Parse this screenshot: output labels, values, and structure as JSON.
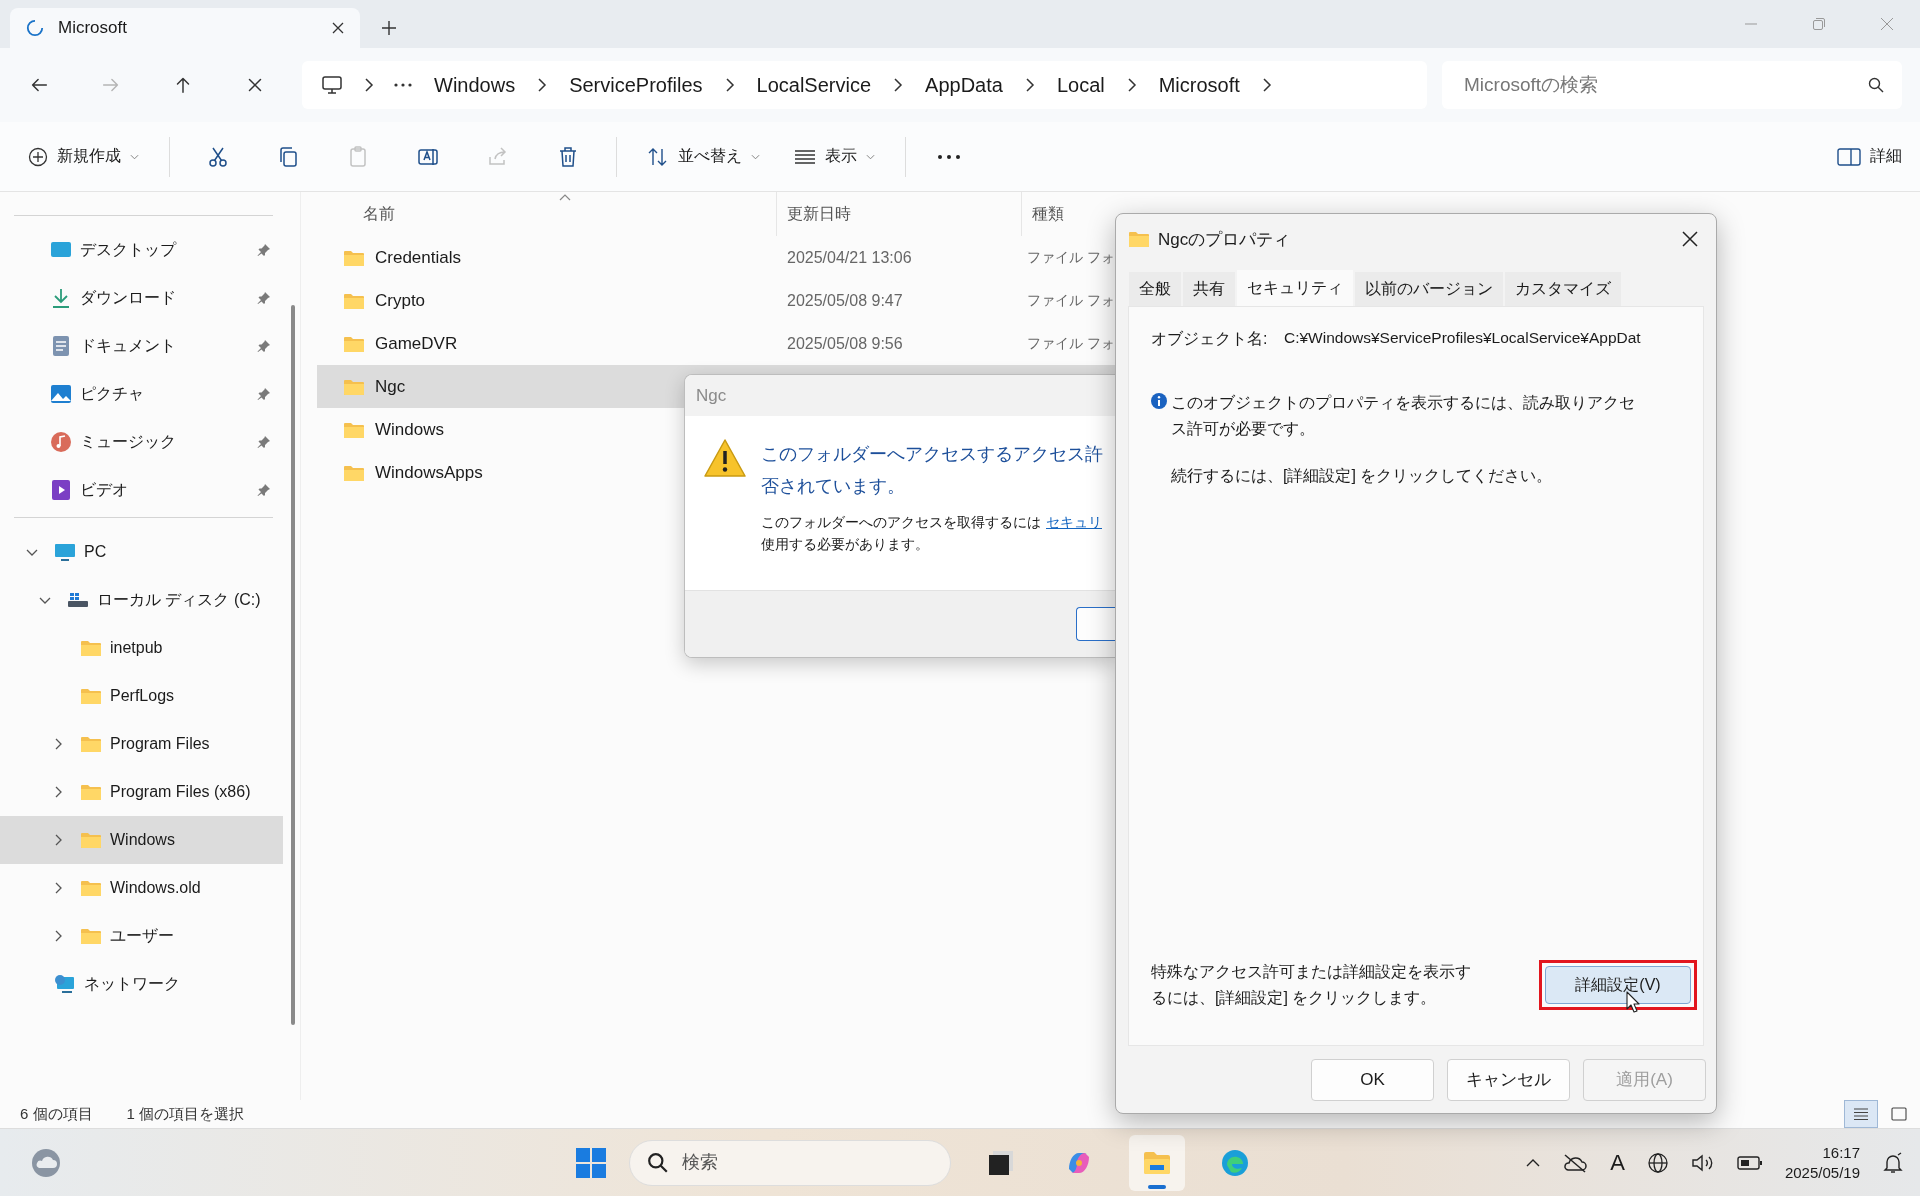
{
  "browser_tab": {
    "title": "Microsoft"
  },
  "nav_buttons": [
    {
      "kind": "back",
      "disabled": false
    },
    {
      "kind": "forward",
      "disabled": true
    },
    {
      "kind": "up",
      "disabled": false
    },
    {
      "kind": "stop",
      "disabled": false
    }
  ],
  "breadcrumbs": [
    "Windows",
    "ServiceProfiles",
    "LocalService",
    "AppData",
    "Local",
    "Microsoft"
  ],
  "search": {
    "placeholder": "Microsoftの検索"
  },
  "toolbar": {
    "new_label": "新規作成",
    "sort_label": "並べ替え",
    "view_label": "表示",
    "details_label": "詳細",
    "actions": [
      {
        "kind": "cut",
        "disabled": false
      },
      {
        "kind": "copy",
        "disabled": false
      },
      {
        "kind": "paste",
        "disabled": true
      },
      {
        "kind": "rename",
        "disabled": false
      },
      {
        "kind": "share",
        "disabled": true
      },
      {
        "kind": "delete",
        "disabled": false
      }
    ]
  },
  "sidebar": {
    "quick_access": [
      {
        "label": "デスクトップ",
        "kind": "desktop",
        "pinned": true
      },
      {
        "label": "ダウンロード",
        "kind": "downloads",
        "pinned": true
      },
      {
        "label": "ドキュメント",
        "kind": "documents",
        "pinned": true
      },
      {
        "label": "ピクチャ",
        "kind": "pictures",
        "pinned": true
      },
      {
        "label": "ミュージック",
        "kind": "music",
        "pinned": true
      },
      {
        "label": "ビデオ",
        "kind": "videos",
        "pinned": true
      }
    ],
    "tree": [
      {
        "label": "PC",
        "kind": "pc",
        "expanded": true,
        "selected": false,
        "children": [
          {
            "label": "ローカル ディスク (C:)",
            "kind": "drive",
            "expanded": true,
            "selected": false,
            "children": [
              {
                "label": "inetpub",
                "kind": "folder",
                "selected": false
              },
              {
                "label": "PerfLogs",
                "kind": "folder",
                "selected": false
              },
              {
                "label": "Program Files",
                "kind": "folder",
                "expanded": false,
                "selected": false
              },
              {
                "label": "Program Files (x86)",
                "kind": "folder",
                "expanded": false,
                "selected": false
              },
              {
                "label": "Windows",
                "kind": "folder",
                "expanded": false,
                "selected": true
              },
              {
                "label": "Windows.old",
                "kind": "folder",
                "expanded": false,
                "selected": false
              },
              {
                "label": "ユーザー",
                "kind": "folder",
                "expanded": false,
                "selected": false
              }
            ]
          }
        ]
      },
      {
        "label": "ネットワーク",
        "kind": "network",
        "selected": false
      }
    ]
  },
  "file_list": {
    "columns": [
      "名前",
      "更新日時",
      "種類"
    ],
    "rows": [
      {
        "name": "Credentials",
        "modified": "2025/04/21 13:06",
        "type": "ファイル フォ",
        "selected": false
      },
      {
        "name": "Crypto",
        "modified": "2025/05/08 9:47",
        "type": "ファイル フォ",
        "selected": false
      },
      {
        "name": "GameDVR",
        "modified": "2025/05/08 9:56",
        "type": "ファイル フォ",
        "selected": false
      },
      {
        "name": "Ngc",
        "selected": true
      },
      {
        "name": "Windows",
        "selected": false
      },
      {
        "name": "WindowsApps",
        "selected": false
      }
    ]
  },
  "status_bar": {
    "item_count": "6 個の項目",
    "selection": "1 個の項目を選択",
    "views": [
      {
        "kind": "details",
        "selected": true
      },
      {
        "kind": "tiles",
        "selected": false
      }
    ]
  },
  "error_dialog": {
    "title": "Ngc",
    "heading_lines": [
      "このフォルダーへアクセスするアクセス許",
      "否されています。"
    ],
    "message_start": "このフォルダーへのアクセスを取得するには",
    "link": "セキュリ",
    "message_end": "使用する必要があります。"
  },
  "properties_dialog": {
    "title": "Ngcのプロパティ",
    "tabs": [
      {
        "label": "全般",
        "selected": false
      },
      {
        "label": "共有",
        "selected": false
      },
      {
        "label": "セキュリティ",
        "selected": true
      },
      {
        "label": "以前のバージョン",
        "selected": false
      },
      {
        "label": "カスタマイズ",
        "selected": false
      }
    ],
    "object_label": "オブジェクト名:",
    "object_path": "C:¥Windows¥ServiceProfiles¥LocalService¥AppDat",
    "info_text": "このオブジェクトのプロパティを表示するには、読み取りアクセス許可が必要です。",
    "continue_text": "続行するには、[詳細設定] をクリックしてください。",
    "advanced_text": "特殊なアクセス許可または詳細設定を表示するには、[詳細設定] をクリックします。",
    "advanced_button": {
      "label": "詳細設定(V)",
      "highlighted": true
    },
    "buttons": [
      {
        "label": "OK",
        "disabled": false
      },
      {
        "label": "キャンセル",
        "disabled": false
      },
      {
        "label": "適用(A)",
        "disabled": true
      }
    ]
  },
  "taskbar": {
    "search_placeholder": "検索",
    "ime": "A",
    "time": "16:17",
    "date": "2025/05/19",
    "apps": [
      {
        "kind": "app",
        "active": false
      },
      {
        "kind": "copilot",
        "active": false
      },
      {
        "kind": "explorer",
        "active": true
      },
      {
        "kind": "edge",
        "active": false
      }
    ]
  }
}
